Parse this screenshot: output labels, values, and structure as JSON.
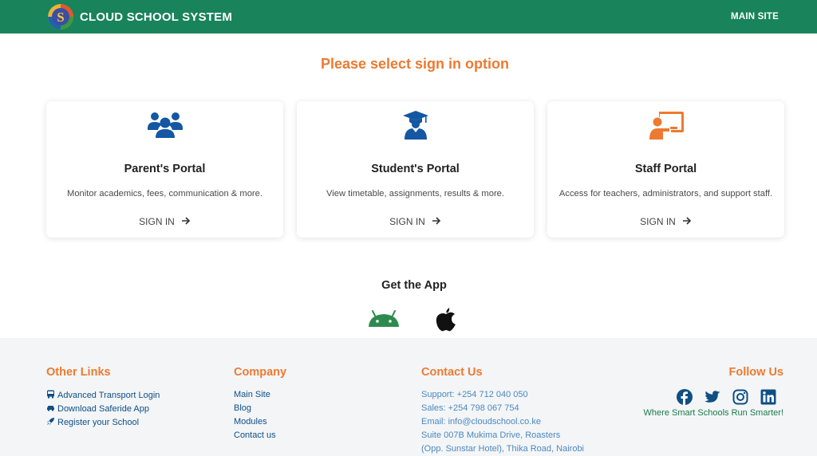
{
  "header": {
    "title": "CLOUD SCHOOL SYSTEM",
    "main_site": "MAIN SITE",
    "colors": {
      "bar": "#19835b"
    }
  },
  "headline": "Please select sign in option",
  "cards": [
    {
      "icon": "users-group-icon",
      "title": "Parent's Portal",
      "description": "Monitor academics, fees, communication & more.",
      "action": "SIGN IN"
    },
    {
      "icon": "graduate-icon",
      "title": "Student's Portal",
      "description": "View timetable, assignments, results & more.",
      "action": "SIGN IN"
    },
    {
      "icon": "teacher-board-icon",
      "title": "Staff Portal",
      "description": "Access for teachers, administrators, and support staff.",
      "action": "SIGN IN"
    }
  ],
  "get_app": {
    "title": "Get the App",
    "icons": [
      "android-icon",
      "apple-icon"
    ]
  },
  "footer": {
    "other_links": {
      "title": "Other Links",
      "items": [
        {
          "icon": "bus-icon",
          "label": "Advanced Transport Login"
        },
        {
          "icon": "car-icon",
          "label": "Download Saferide App"
        },
        {
          "icon": "rocket-icon",
          "label": "Register your School"
        }
      ]
    },
    "company": {
      "title": "Company",
      "items": [
        "Main Site",
        "Blog",
        "Modules",
        "Contact us"
      ]
    },
    "contact": {
      "title": "Contact Us",
      "lines": [
        "Support: +254 712 040 050",
        "Sales: +254 798 067 754",
        "Email: info@cloudschool.co.ke",
        "Suite 007B Mukima Drive, Roasters",
        "(Opp. Sunstar Hotel), Thika Road, Nairobi"
      ]
    },
    "follow": {
      "title": "Follow Us",
      "icons": [
        "facebook-icon",
        "twitter-icon",
        "instagram-icon",
        "linkedin-icon"
      ],
      "tagline": "Where Smart Schools Run Smarter!"
    }
  },
  "colors": {
    "accent": "#ed7a30",
    "primary_blue": "#0f4f84",
    "green": "#19835b"
  }
}
